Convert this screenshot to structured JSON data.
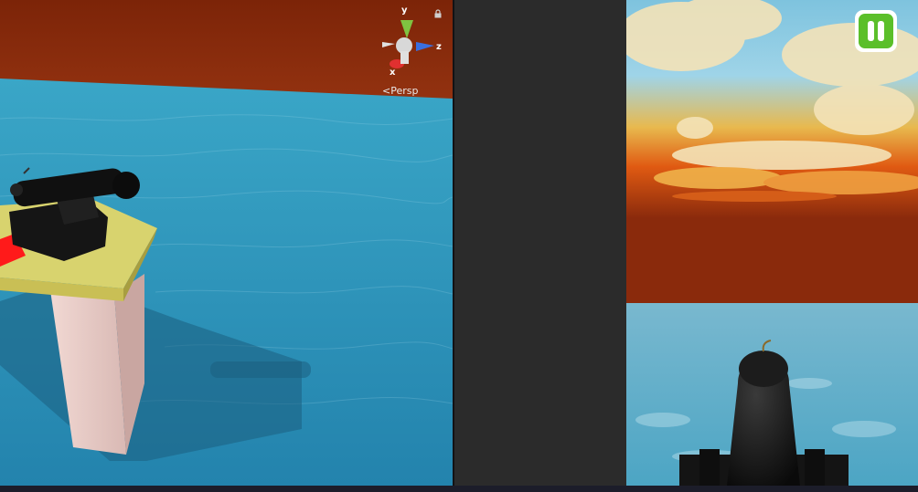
{
  "scene_view": {
    "projection_label": "Persp",
    "gizmo": {
      "x_label": "x",
      "y_label": "y",
      "z_label": "z"
    }
  },
  "game_view": {
    "pause_button": {
      "icon": "pause-icon",
      "color": "#5bbf2a"
    }
  },
  "colors": {
    "water": "#2f8fb2",
    "backdrop": "#8a2a0c",
    "platform_top": "#d6d06a",
    "pillar": "#e4c7c2",
    "cannon": "#151515",
    "marker": "#ff1a1a"
  }
}
